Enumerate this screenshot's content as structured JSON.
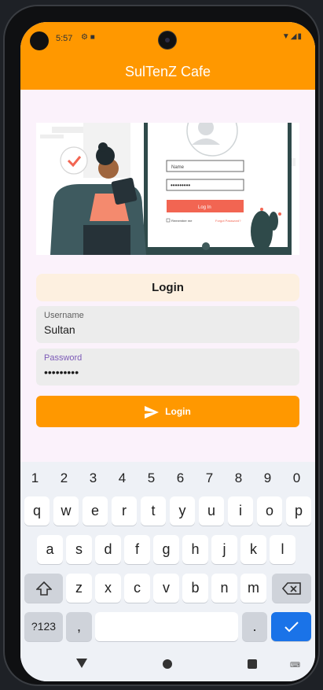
{
  "status": {
    "time": "5:57"
  },
  "appbar": {
    "title": "SulTenZ Cafe"
  },
  "illustration": {
    "name_placeholder": "Name",
    "password_dots": "•••••••••",
    "button_label": "Log In",
    "remember": "Remember me",
    "forgot": "Forgot Password?"
  },
  "login": {
    "heading": "Login",
    "username_label": "Username",
    "username_value": "Sultan",
    "password_label": "Password",
    "password_value": "•••••••••",
    "button_label": "Login"
  },
  "keyboard": {
    "numbers": [
      "1",
      "2",
      "3",
      "4",
      "5",
      "6",
      "7",
      "8",
      "9",
      "0"
    ],
    "row1": [
      "q",
      "w",
      "e",
      "r",
      "t",
      "y",
      "u",
      "i",
      "o",
      "p"
    ],
    "row2": [
      "a",
      "s",
      "d",
      "f",
      "g",
      "h",
      "j",
      "k",
      "l"
    ],
    "row3": [
      "z",
      "x",
      "c",
      "v",
      "b",
      "n",
      "m"
    ],
    "symbols_label": "?123",
    "comma": ",",
    "period": "."
  },
  "colors": {
    "primary": "#ff9800",
    "background": "#fbf2fb",
    "accent": "#1a73e8"
  }
}
